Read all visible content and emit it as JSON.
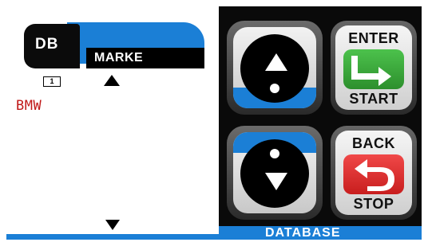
{
  "screen": {
    "db_badge": "DB",
    "tab_title": "MARKE",
    "page_number": "1",
    "list_items": [
      "BMW"
    ]
  },
  "controls": {
    "up_icon": "arrow-up-icon",
    "down_icon": "arrow-down-icon",
    "enter_label": "ENTER",
    "start_label": "START",
    "back_label": "BACK",
    "stop_label": "STOP",
    "footer_label": "DATABASE"
  },
  "colors": {
    "accent_blue": "#1b7fd6",
    "enter_green": "#3aa53a",
    "stop_red": "#e23030",
    "item_red": "#c01818"
  }
}
